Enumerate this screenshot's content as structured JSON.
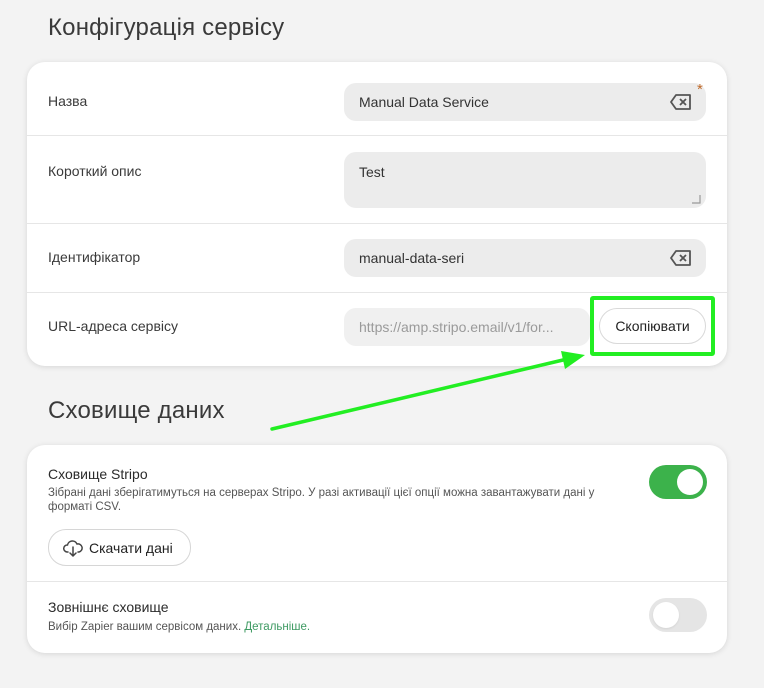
{
  "config": {
    "title": "Конфігурація сервісу",
    "name_label": "Назва",
    "name_value": "Manual Data Service",
    "required_mark": "*",
    "desc_label": "Короткий опис",
    "desc_value": "Test",
    "id_label": "Ідентифікатор",
    "id_value": "manual-data-seri",
    "url_label": "URL-адреса сервісу",
    "url_value": "https://amp.stripo.email/v1/for...",
    "copy_button": "Скопіювати"
  },
  "storage": {
    "title": "Сховище даних",
    "stripo_title": "Сховище Stripo",
    "stripo_desc": "Зібрані дані зберігатимуться на серверах Stripo. У разі активації цієї опції можна завантажувати дані у форматі CSV.",
    "stripo_enabled": true,
    "download_button": "Скачати дані",
    "external_title": "Зовнішнє сховище",
    "external_desc": "Вибір Zapier вашим сервісом даних.",
    "external_link": "Детальніше.",
    "external_enabled": false
  },
  "colors": {
    "highlight": "#22ee22",
    "toggle_on": "#3cb24b",
    "link": "#3e9a62"
  },
  "icons": [
    "clear-input-icon",
    "resize-handle-icon",
    "cloud-download-icon"
  ]
}
